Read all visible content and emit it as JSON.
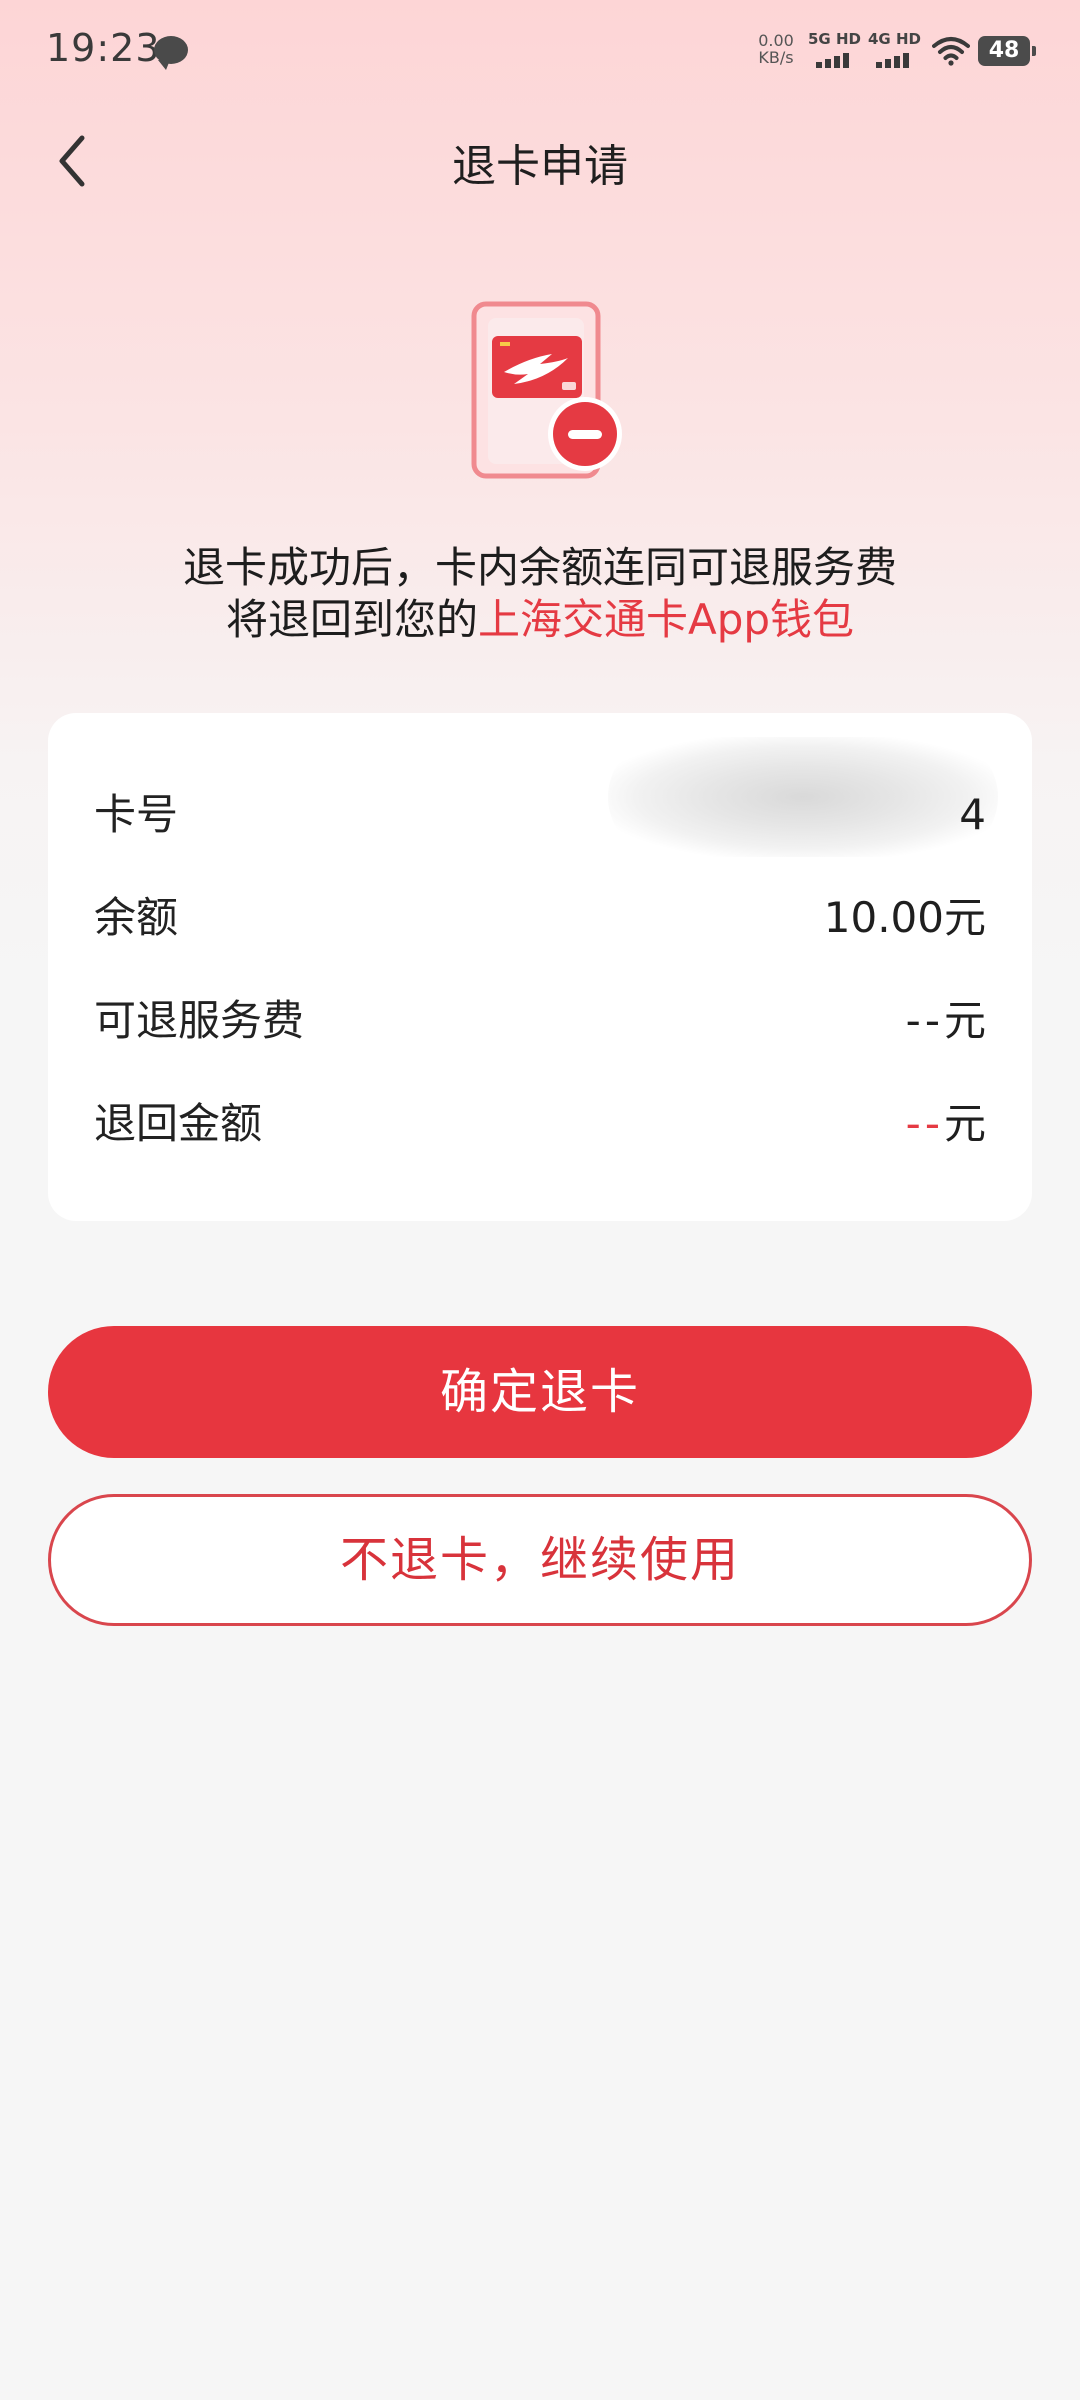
{
  "status_bar": {
    "time": "19:23",
    "net_speed_value": "0.00",
    "net_speed_unit": "KB/s",
    "signal1_label": "5G HD",
    "signal2_label": "4G HD",
    "battery": "48",
    "icons": [
      "chat-bubble-icon",
      "wifi-icon",
      "battery-icon"
    ]
  },
  "header": {
    "title": "退卡申请",
    "back_icon": "chevron-left-icon"
  },
  "illustration": {
    "icon": "card-remove-icon",
    "accent_color": "#e53a43"
  },
  "notice": {
    "line1": "退卡成功后，卡内余额连同可退服务费",
    "line2_prefix": "将退回到您的",
    "line2_highlight": "上海交通卡App钱包"
  },
  "info": {
    "card_number_label": "卡号",
    "card_number_value": "4",
    "balance_label": "余额",
    "balance_value": "10.00元",
    "service_fee_label": "可退服务费",
    "service_fee_value": "--",
    "service_fee_unit": "元",
    "refund_label": "退回金额",
    "refund_value": "--",
    "refund_unit": "元"
  },
  "actions": {
    "confirm_label": "确定退卡",
    "cancel_label": "不退卡，继续使用"
  },
  "colors": {
    "primary": "#e7363f",
    "highlight_text": "#e53a43",
    "background": "#f6f6f6",
    "header_gradient_top": "#fdd5d6"
  }
}
